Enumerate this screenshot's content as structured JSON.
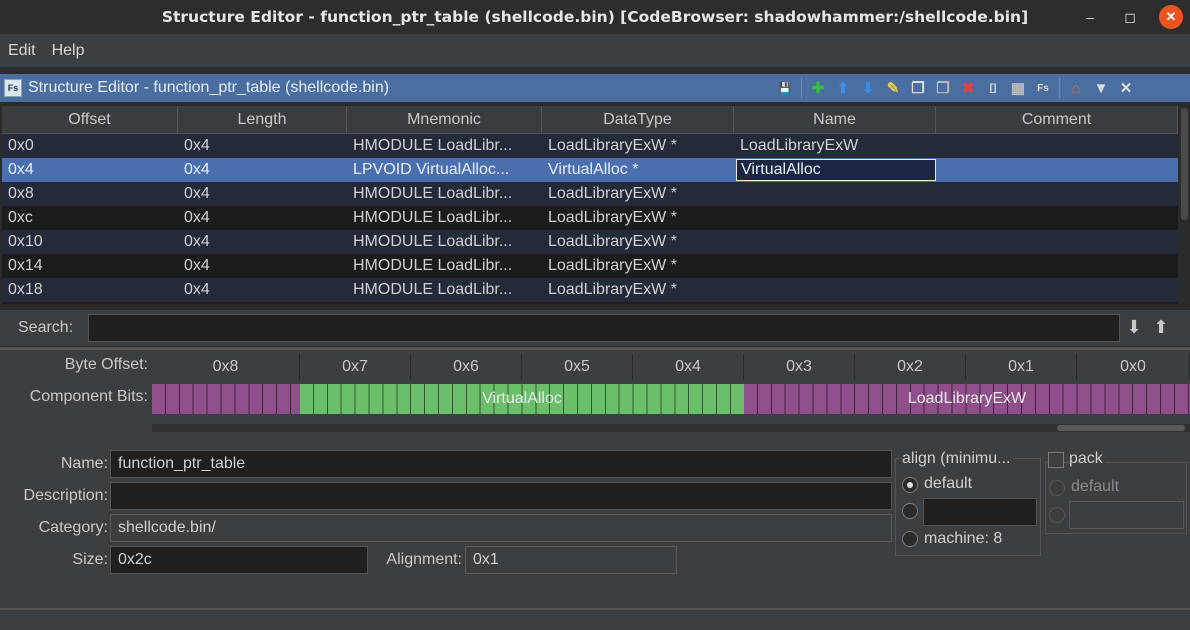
{
  "window": {
    "title": "Structure Editor - function_ptr_table (shellcode.bin) [CodeBrowser: shadowhammer:/shellcode.bin]",
    "min_glyph": "–",
    "max_glyph": "◻",
    "close_glyph": "✕"
  },
  "menu": {
    "edit": "Edit",
    "help": "Help"
  },
  "panel": {
    "icon_text": "Fs",
    "title": "Structure Editor - function_ptr_table (shellcode.bin)"
  },
  "toolbar_icons": [
    {
      "name": "save-icon",
      "glyph": "💾",
      "color": "#4a90d9"
    },
    {
      "name": "add-icon",
      "glyph": "✚",
      "color": "#3dbb3d"
    },
    {
      "name": "move-up-icon",
      "glyph": "⬆",
      "color": "#3a8ee6"
    },
    {
      "name": "move-down-icon",
      "glyph": "⬇",
      "color": "#3a8ee6"
    },
    {
      "name": "clear-icon",
      "glyph": "✎",
      "color": "#e8c84a"
    },
    {
      "name": "duplicate-icon",
      "glyph": "❐",
      "color": "#dddddd"
    },
    {
      "name": "duplicate-multiple-icon",
      "glyph": "❐",
      "color": "#bbbbbb"
    },
    {
      "name": "delete-icon",
      "glyph": "✖",
      "color": "#e04040"
    },
    {
      "name": "array-icon",
      "glyph": "[]",
      "color": "#dddddd"
    },
    {
      "name": "unpackage-icon",
      "glyph": "▦",
      "color": "#bbbbbb"
    },
    {
      "name": "edit-component-icon",
      "glyph": "Fs",
      "color": "#dddddd"
    },
    {
      "name": "home-icon",
      "glyph": "⌂",
      "color": "#e86040"
    },
    {
      "name": "menu-dropdown-icon",
      "glyph": "▼",
      "color": "#dddddd"
    },
    {
      "name": "close-panel-icon",
      "glyph": "✕",
      "color": "#dddddd"
    }
  ],
  "table": {
    "headers": [
      "Offset",
      "Length",
      "Mnemonic",
      "DataType",
      "Name",
      "Comment"
    ],
    "rows": [
      [
        "0x0",
        "0x4",
        "HMODULE LoadLibr...",
        "LoadLibraryExW *",
        "LoadLibraryExW",
        ""
      ],
      [
        "0x4",
        "0x4",
        "LPVOID VirtualAlloc...",
        "VirtualAlloc *",
        "VirtualAlloc",
        ""
      ],
      [
        "0x8",
        "0x4",
        "HMODULE LoadLibr...",
        "LoadLibraryExW *",
        "",
        ""
      ],
      [
        "0xc",
        "0x4",
        "HMODULE LoadLibr...",
        "LoadLibraryExW *",
        "",
        ""
      ],
      [
        "0x10",
        "0x4",
        "HMODULE LoadLibr...",
        "LoadLibraryExW *",
        "",
        ""
      ],
      [
        "0x14",
        "0x4",
        "HMODULE LoadLibr...",
        "LoadLibraryExW *",
        "",
        ""
      ],
      [
        "0x18",
        "0x4",
        "HMODULE LoadLibr...",
        "LoadLibraryExW *",
        "",
        ""
      ]
    ],
    "selected_row": 1
  },
  "search": {
    "label": "Search:",
    "value": "",
    "down_glyph": "⬇",
    "up_glyph": "⬆"
  },
  "bitview": {
    "byte_offset_label": "Byte Offset:",
    "component_bits_label": "Component Bits:",
    "offsets": [
      "0x8",
      "0x7",
      "0x6",
      "0x5",
      "0x4",
      "0x3",
      "0x2",
      "0x1",
      "0x0"
    ],
    "segments": [
      {
        "label": "",
        "color": "#8e4f8a"
      },
      {
        "label": "VirtualAlloc",
        "color": "#6bbf6b"
      },
      {
        "label": "LoadLibraryExW",
        "color": "#8e4f8a"
      }
    ]
  },
  "form": {
    "name_label": "Name:",
    "name_value": "function_ptr_table",
    "description_label": "Description:",
    "description_value": "",
    "category_label": "Category:",
    "category_value": "shellcode.bin/",
    "size_label": "Size:",
    "size_value": "0x2c",
    "alignment_label": "Alignment:",
    "alignment_value": "0x1",
    "align_group_label": "align (minimu...",
    "align_default": "default",
    "align_machine": "machine: 8",
    "pack_label": "pack",
    "pack_default": "default"
  }
}
